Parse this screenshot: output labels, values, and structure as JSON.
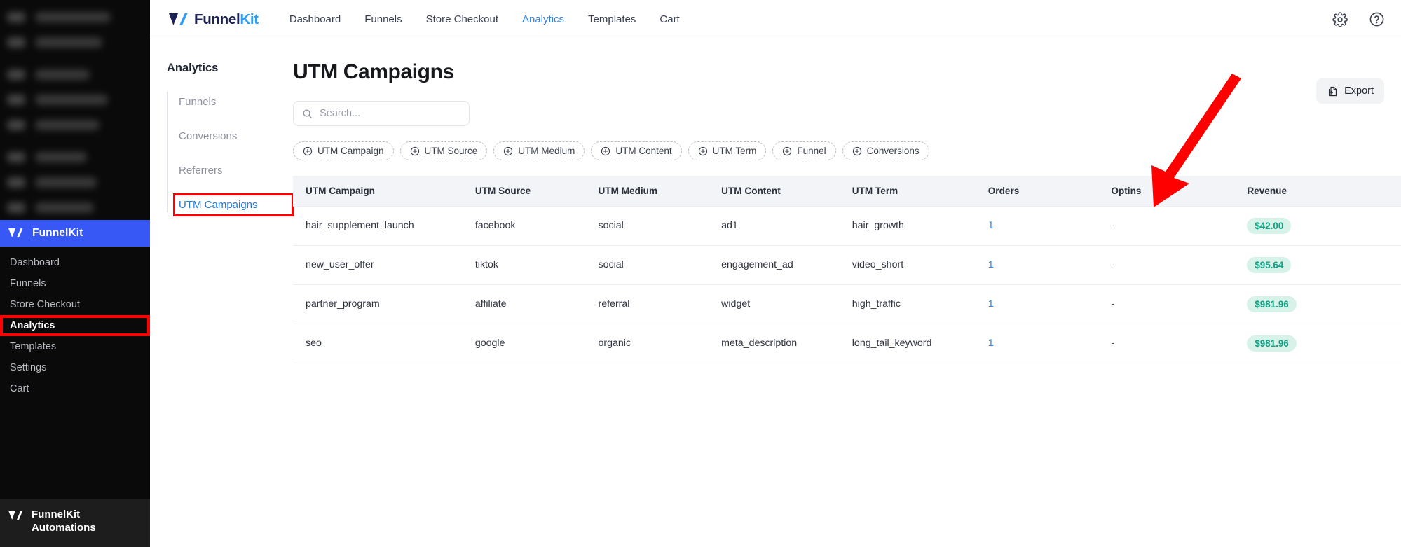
{
  "wp_sidebar": {
    "blurred_item_count": 8,
    "brand": {
      "name": "FunnelKit",
      "icon": "funnelkit-logo-icon",
      "bg_color": "#3858f6"
    },
    "menu": [
      {
        "label": "Dashboard",
        "active": false,
        "highlighted": false
      },
      {
        "label": "Funnels",
        "active": false,
        "highlighted": false
      },
      {
        "label": "Store Checkout",
        "active": false,
        "highlighted": false
      },
      {
        "label": "Analytics",
        "active": true,
        "highlighted": true
      },
      {
        "label": "Templates",
        "active": false,
        "highlighted": false
      },
      {
        "label": "Settings",
        "active": false,
        "highlighted": false
      },
      {
        "label": "Cart",
        "active": false,
        "highlighted": false
      }
    ],
    "footer": {
      "line1": "FunnelKit",
      "line2": "Automations",
      "icon": "funnelkit-logo-icon"
    }
  },
  "topbar": {
    "logo": {
      "part1": "Funnel",
      "part2": "Kit",
      "icon": "funnelkit-logo-icon"
    },
    "nav": [
      {
        "label": "Dashboard",
        "active": false
      },
      {
        "label": "Funnels",
        "active": false
      },
      {
        "label": "Store Checkout",
        "active": false
      },
      {
        "label": "Analytics",
        "active": true
      },
      {
        "label": "Templates",
        "active": false
      },
      {
        "label": "Cart",
        "active": false
      }
    ],
    "settings_icon": "gear-icon",
    "help_icon": "question-mark-circle-icon"
  },
  "subnav": {
    "title": "Analytics",
    "items": [
      {
        "label": "Funnels",
        "active": false,
        "highlighted": false
      },
      {
        "label": "Conversions",
        "active": false,
        "highlighted": false
      },
      {
        "label": "Referrers",
        "active": false,
        "highlighted": false
      },
      {
        "label": "UTM Campaigns",
        "active": true,
        "highlighted": true
      }
    ]
  },
  "content": {
    "page_title": "UTM Campaigns",
    "search": {
      "placeholder": "Search...",
      "value": "",
      "icon": "search-icon"
    },
    "export": {
      "label": "Export",
      "icon": "export-document-icon"
    },
    "filter_chips": [
      {
        "label": "UTM Campaign",
        "icon": "plus-circle-icon"
      },
      {
        "label": "UTM Source",
        "icon": "plus-circle-icon"
      },
      {
        "label": "UTM Medium",
        "icon": "plus-circle-icon"
      },
      {
        "label": "UTM Content",
        "icon": "plus-circle-icon"
      },
      {
        "label": "UTM Term",
        "icon": "plus-circle-icon"
      },
      {
        "label": "Funnel",
        "icon": "plus-circle-icon"
      },
      {
        "label": "Conversions",
        "icon": "plus-circle-icon"
      }
    ],
    "table": {
      "columns": [
        "UTM Campaign",
        "UTM Source",
        "UTM Medium",
        "UTM Content",
        "UTM Term",
        "Orders",
        "Optins",
        "Revenue"
      ],
      "rows": [
        {
          "utm_campaign": "hair_supplement_launch",
          "utm_source": "facebook",
          "utm_medium": "social",
          "utm_content": "ad1",
          "utm_term": "hair_growth",
          "orders": "1",
          "optins": "-",
          "revenue": "$42.00"
        },
        {
          "utm_campaign": "new_user_offer",
          "utm_source": "tiktok",
          "utm_medium": "social",
          "utm_content": "engagement_ad",
          "utm_term": "video_short",
          "orders": "1",
          "optins": "-",
          "revenue": "$95.64"
        },
        {
          "utm_campaign": "partner_program",
          "utm_source": "affiliate",
          "utm_medium": "referral",
          "utm_content": "widget",
          "utm_term": "high_traffic",
          "orders": "1",
          "optins": "-",
          "revenue": "$981.96"
        },
        {
          "utm_campaign": "seo",
          "utm_source": "google",
          "utm_medium": "organic",
          "utm_content": "meta_description",
          "utm_term": "long_tail_keyword",
          "orders": "1",
          "optins": "-",
          "revenue": "$981.96"
        }
      ]
    }
  },
  "annotations": {
    "arrow": {
      "color": "#ff0000",
      "points_to": "export-button"
    },
    "highlight_color": "#ff0000"
  }
}
